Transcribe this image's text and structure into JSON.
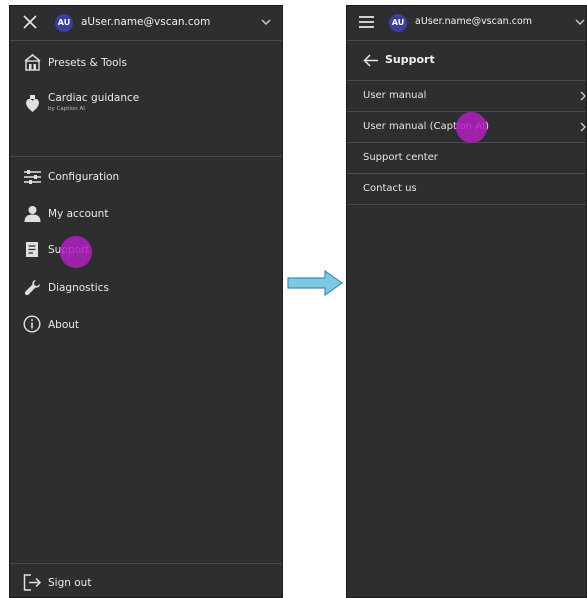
{
  "left_panel": {
    "header": {
      "avatar_initials": "AU",
      "email": "aUser.name@vscan.com"
    },
    "menu": [
      {
        "label": "Presets & Tools",
        "icon": "presets-tools-icon"
      },
      {
        "label": "Cardiac guidance",
        "sublabel": "by Caption AI",
        "icon": "heart-probe-icon"
      },
      {
        "label": "Configuration",
        "icon": "sliders-icon"
      },
      {
        "label": "My account",
        "icon": "user-icon"
      },
      {
        "label": "Support",
        "icon": "document-icon"
      },
      {
        "label": "Diagnostics",
        "icon": "wrench-icon"
      },
      {
        "label": "About",
        "icon": "info-icon"
      }
    ],
    "sign_out_label": "Sign out"
  },
  "right_panel": {
    "header": {
      "avatar_initials": "AU",
      "email": "aUser.name@vscan.com"
    },
    "title": "Support",
    "items": [
      {
        "label": "User manual"
      },
      {
        "label": "User manual (Caption AI)"
      },
      {
        "label": "Support center"
      },
      {
        "label": "Contact us"
      }
    ]
  },
  "colors": {
    "panel_bg": "#2e2e30",
    "touch_indicator": "#b21ec0",
    "avatar_bg": "#3b3f9e",
    "flow_arrow": "#7ec8e3"
  }
}
